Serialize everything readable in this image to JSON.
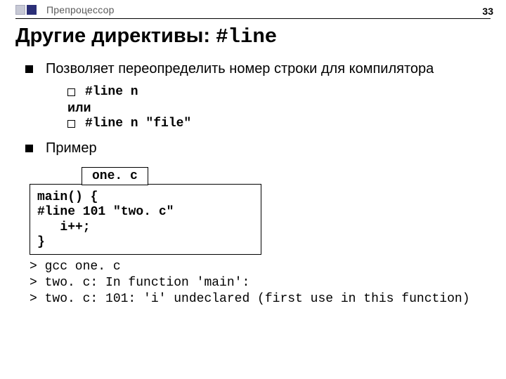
{
  "page_number": "33",
  "breadcrumb": "Препроцессор",
  "title_prefix": "Другие директивы: ",
  "title_code": "#line",
  "point1": "Позволяет переопределить номер строки для компилятора",
  "sub1a": "#line n",
  "or_label": "или",
  "sub1b": "#line n \"file\"",
  "point2": "Пример",
  "code_filename": "one. c",
  "code_body": "main() {\n#line 101 \"two. c\"\n   i++;\n}",
  "terminal": "> gcc one. c\n> two. c: In function 'main':\n> two. c: 101: 'i' undeclared (first use in this function)"
}
